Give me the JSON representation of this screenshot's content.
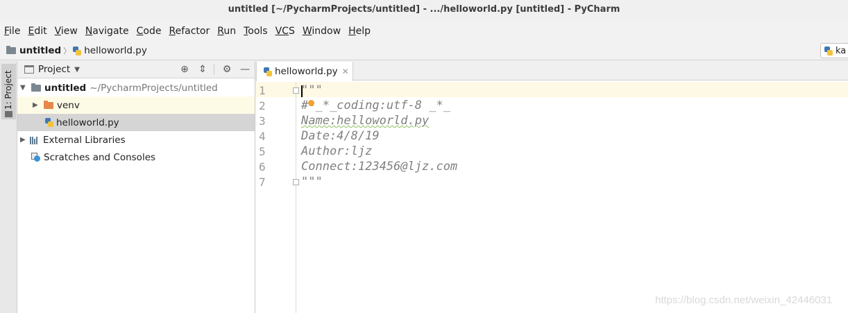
{
  "window": {
    "title": "untitled [~/PycharmProjects/untitled] - .../helloworld.py [untitled] - PyCharm"
  },
  "menu": [
    {
      "first": "F",
      "rest": "ile"
    },
    {
      "first": "E",
      "rest": "dit"
    },
    {
      "first": "V",
      "rest": "iew"
    },
    {
      "first": "N",
      "rest": "avigate"
    },
    {
      "first": "C",
      "rest": "ode"
    },
    {
      "first": "R",
      "rest": "efactor"
    },
    {
      "first": "R",
      "rest": "un"
    },
    {
      "first": "T",
      "rest": "ools"
    },
    {
      "first": "VC",
      "rest": "S"
    },
    {
      "first": "W",
      "rest": "indow"
    },
    {
      "first": "H",
      "rest": "elp"
    }
  ],
  "breadcrumb": {
    "project": "untitled",
    "file": "helloworld.py"
  },
  "run_config": {
    "label": "ka"
  },
  "side_stripe": {
    "label": "1: Project"
  },
  "project_panel": {
    "title": "Project",
    "tree": {
      "root_name": "untitled",
      "root_path": "~/PycharmProjects/untitled",
      "venv": "venv",
      "file": "helloworld.py",
      "external": "External Libraries",
      "scratches": "Scratches and Consoles"
    }
  },
  "editor": {
    "tab": "helloworld.py",
    "line_numbers": [
      "1",
      "2",
      "3",
      "4",
      "5",
      "6",
      "7"
    ],
    "lines": [
      "\"\"\"",
      "#-_*_coding:utf-8 _*_",
      "Name:helloworld.py",
      "Date:4/8/19",
      "Author:ljz",
      "Connect:123456@ljz.com",
      "\"\"\""
    ]
  },
  "watermark": "https://blog.csdn.net/weixin_42446031",
  "colors": {
    "highlight_line": "#fdf9e4",
    "venv_row": "#fdfbe6",
    "selected_row": "#d5d5d5",
    "folder_orange": "#e8874c"
  }
}
